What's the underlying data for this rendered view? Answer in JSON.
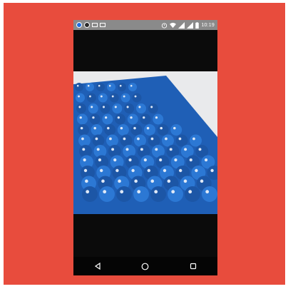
{
  "status_bar": {
    "time": "10:19",
    "left_icons": [
      "circle-blue-icon",
      "circle-dark-icon",
      "message-icon",
      "image-icon"
    ],
    "right_icons": [
      "alarm-icon",
      "wifi-icon",
      "signal-icon",
      "signal-icon",
      "battery-icon"
    ]
  },
  "photo": {
    "icon": "image-viewer-content",
    "colors": {
      "barrel": "#2c78d4",
      "barrel_dark": "#1c56a6",
      "wall": "#e9eaec",
      "floor": "#c9cacc"
    }
  },
  "nav_bar": {
    "items": [
      "back-icon",
      "home-icon",
      "recents-icon"
    ]
  },
  "colors": {
    "frame": "#e84c3d",
    "screen": "#0b0b0b",
    "status": "#8a8a8a"
  }
}
